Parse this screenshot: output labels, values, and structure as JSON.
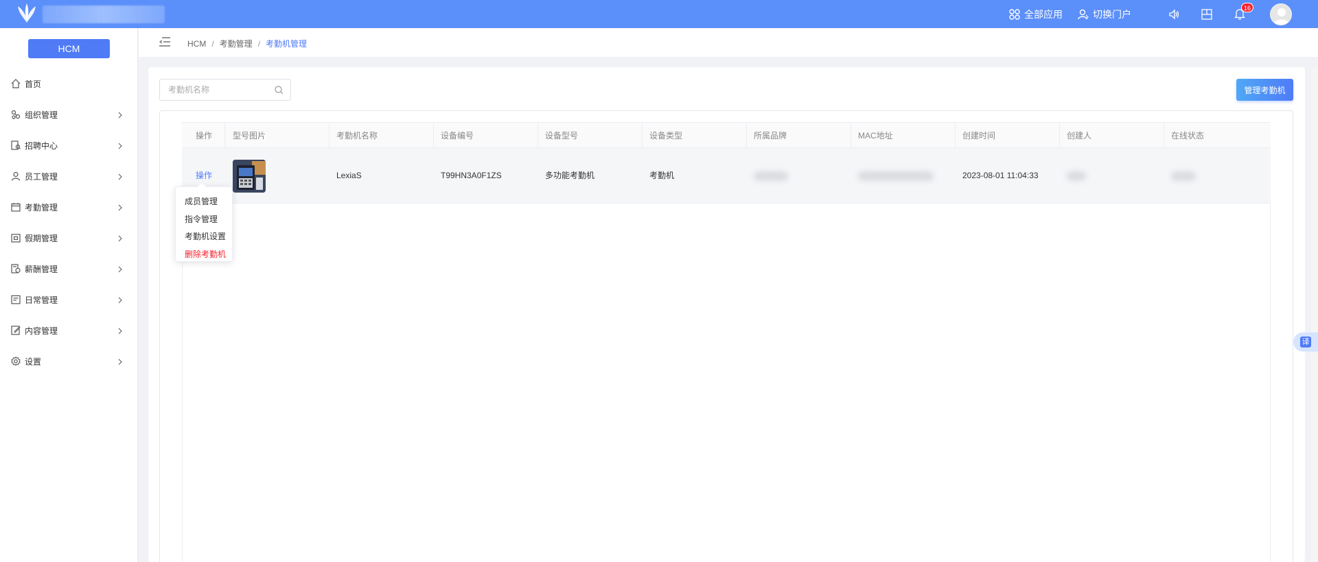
{
  "topbar": {
    "all_apps_label": "全部应用",
    "switch_portal_label": "切换门户",
    "notification_count": "16"
  },
  "sidebar": {
    "system_button": "HCM",
    "items": [
      {
        "label": "首页",
        "icon": "home-icon",
        "has_children": false
      },
      {
        "label": "组织管理",
        "icon": "org-icon",
        "has_children": true
      },
      {
        "label": "招聘中心",
        "icon": "recruit-icon",
        "has_children": true
      },
      {
        "label": "员工管理",
        "icon": "user-icon",
        "has_children": true
      },
      {
        "label": "考勤管理",
        "icon": "calendar-icon",
        "has_children": true
      },
      {
        "label": "假期管理",
        "icon": "holiday-icon",
        "has_children": true
      },
      {
        "label": "薪酬管理",
        "icon": "salary-icon",
        "has_children": true
      },
      {
        "label": "日常管理",
        "icon": "daily-icon",
        "has_children": true
      },
      {
        "label": "内容管理",
        "icon": "content-icon",
        "has_children": true
      },
      {
        "label": "设置",
        "icon": "gear-icon",
        "has_children": true
      }
    ]
  },
  "breadcrumb": [
    "HCM",
    "考勤管理",
    "考勤机管理"
  ],
  "search": {
    "placeholder": "考勤机名称",
    "value": ""
  },
  "manage_button": "管理考勤机",
  "table": {
    "columns": [
      "操作",
      "型号图片",
      "考勤机名称",
      "设备编号",
      "设备型号",
      "设备类型",
      "所属品牌",
      "MAC地址",
      "创建时间",
      "创建人",
      "在线状态"
    ],
    "rows": [
      {
        "action": "操作",
        "name": "LexiaS",
        "device_no": "T99HN3A0F1ZS",
        "model": "多功能考勤机",
        "type": "考勤机",
        "created_at": "2023-08-01 11:04:33"
      }
    ]
  },
  "action_menu": [
    {
      "label": "成员管理",
      "danger": false
    },
    {
      "label": "指令管理",
      "danger": false
    },
    {
      "label": "考勤机设置",
      "danger": false
    },
    {
      "label": "删除考勤机",
      "danger": true
    }
  ],
  "translate_tab": "译",
  "colors": {
    "primary": "#4f7bf7",
    "topbar": "#5b8ff9",
    "danger": "#f5222d"
  }
}
